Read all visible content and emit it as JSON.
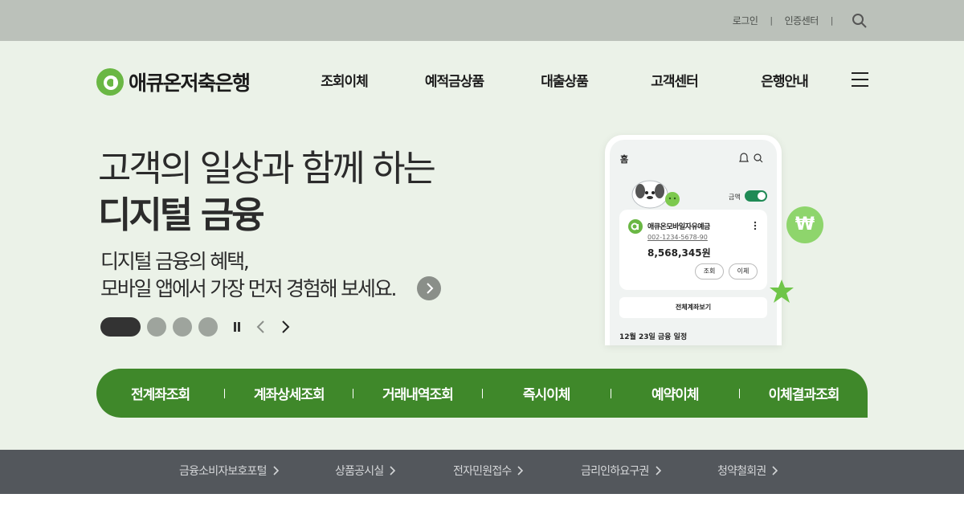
{
  "utility": {
    "login": "로그인",
    "cert_center": "인증센터",
    "separator": "|",
    "search_icon": "search-icon"
  },
  "header": {
    "logo_text": "애큐온저축은행",
    "brand_color": "#6ab744",
    "menu": [
      "조회이체",
      "예적금상품",
      "대출상품",
      "고객센터",
      "은행안내"
    ],
    "menu_icon": "hamburger-icon"
  },
  "hero": {
    "headline_line1": "고객의 일상과 함께 하는",
    "headline_line2": "디지털 금융",
    "subcopy_line1": "디지털 금융의 혜택,",
    "subcopy_line2": "모바일 앱에서 가장 먼저 경험해 보세요.",
    "slides_total": 4,
    "active_slide": 1,
    "background": "#ebf2e8"
  },
  "phone": {
    "home_label": "홈",
    "toggle_label": "금액",
    "account_name": "애큐온모바일자유예금",
    "account_number": "002-1234-5678-90",
    "balance": "8,568,345원",
    "btn_inquiry": "조회",
    "btn_transfer": "이체",
    "all_accounts": "전체계좌보기",
    "schedule": "12월 23일 금융 일정",
    "won_symbol": "₩"
  },
  "quick_menu": {
    "color": "#3f882a",
    "items": [
      "전계좌조회",
      "계좌상세조회",
      "거래내역조회",
      "즉시이체",
      "예약이체",
      "이체결과조회"
    ]
  },
  "footer": {
    "color": "#53575c",
    "links": [
      "금융소비자보호포털",
      "상품공시실",
      "전자민원접수",
      "금리인하요구권",
      "청약철회권"
    ]
  }
}
